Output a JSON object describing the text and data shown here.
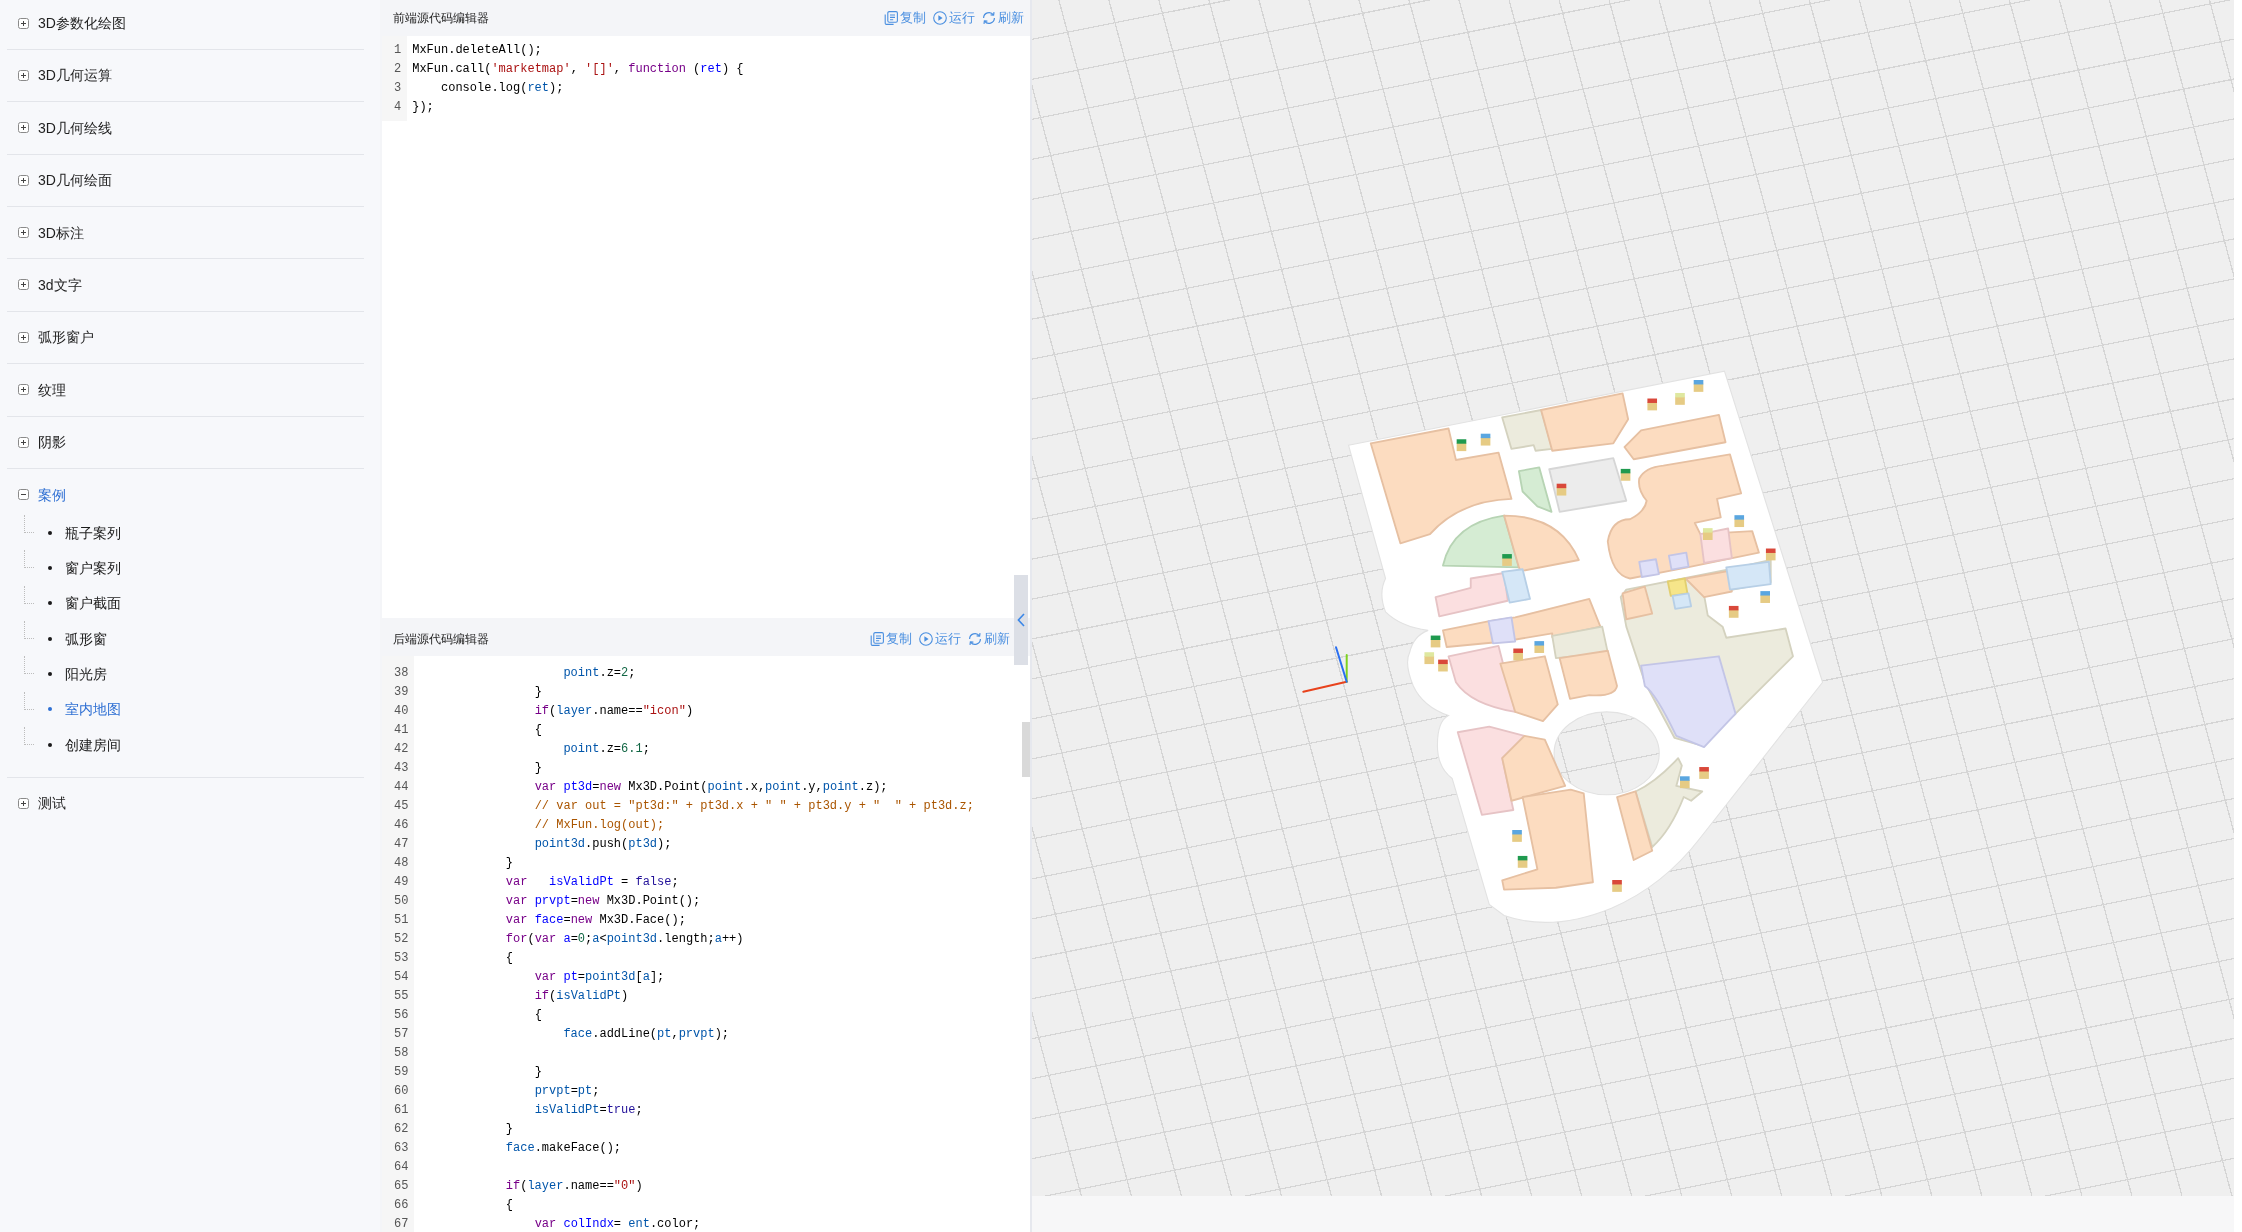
{
  "sidebar": {
    "items": [
      {
        "label": "3D参数化绘图",
        "expanded": false,
        "selected": false
      },
      {
        "label": "3D几何运算",
        "expanded": false,
        "selected": false
      },
      {
        "label": "3D几何绘线",
        "expanded": false,
        "selected": false
      },
      {
        "label": "3D几何绘面",
        "expanded": false,
        "selected": false
      },
      {
        "label": "3D标注",
        "expanded": false,
        "selected": false
      },
      {
        "label": "3d文字",
        "expanded": false,
        "selected": false
      },
      {
        "label": "弧形窗户",
        "expanded": false,
        "selected": false
      },
      {
        "label": "纹理",
        "expanded": false,
        "selected": false
      },
      {
        "label": "阴影",
        "expanded": false,
        "selected": false
      },
      {
        "label": "案例",
        "expanded": true,
        "selected": true,
        "children": [
          {
            "label": "瓶子案列",
            "selected": false
          },
          {
            "label": "窗户案列",
            "selected": false
          },
          {
            "label": "窗户截面",
            "selected": false
          },
          {
            "label": "弧形窗",
            "selected": false
          },
          {
            "label": "阳光房",
            "selected": false
          },
          {
            "label": "室内地图",
            "selected": true
          },
          {
            "label": "创建房间",
            "selected": false
          }
        ]
      },
      {
        "label": "测试",
        "expanded": false,
        "selected": false
      }
    ]
  },
  "editors": [
    {
      "title": "前端源代码编辑器",
      "actions": [
        {
          "kind": "copy",
          "label": "复制"
        },
        {
          "kind": "run",
          "label": "运行"
        },
        {
          "kind": "refresh",
          "label": "刷新"
        }
      ],
      "lines": [
        {
          "number": "1",
          "code": [
            {
              "kind": "plain",
              "text": "MxFun.deleteAll();"
            }
          ]
        },
        {
          "number": "2",
          "code": [
            {
              "kind": "plain",
              "text": "MxFun.call("
            },
            {
              "kind": "string",
              "text": "'marketmap'"
            },
            {
              "kind": "plain",
              "text": ", "
            },
            {
              "kind": "string",
              "text": "'[]'"
            },
            {
              "kind": "plain",
              "text": ", "
            },
            {
              "kind": "keyword",
              "text": "function"
            },
            {
              "kind": "plain",
              "text": " ("
            },
            {
              "kind": "def",
              "text": "ret"
            },
            {
              "kind": "plain",
              "text": ") {"
            }
          ]
        },
        {
          "number": "3",
          "code": [
            {
              "kind": "plain",
              "text": "    console.log("
            },
            {
              "kind": "variable",
              "text": "ret"
            },
            {
              "kind": "plain",
              "text": ");"
            }
          ]
        },
        {
          "number": "4",
          "code": [
            {
              "kind": "plain",
              "text": "});"
            }
          ]
        }
      ]
    },
    {
      "title": "后端源代码编辑器",
      "actions": [
        {
          "kind": "copy",
          "label": "复制"
        },
        {
          "kind": "run",
          "label": "运行"
        },
        {
          "kind": "refresh",
          "label": "刷新"
        }
      ],
      "lines": [
        {
          "number": "38",
          "code": [
            {
              "kind": "variable",
              "text": "                    point"
            },
            {
              "kind": "plain",
              "text": ".z="
            },
            {
              "kind": "number",
              "text": "2"
            },
            {
              "kind": "plain",
              "text": ";"
            }
          ]
        },
        {
          "number": "39",
          "code": [
            {
              "kind": "plain",
              "text": "                }"
            }
          ]
        },
        {
          "number": "40",
          "code": [
            {
              "kind": "keyword",
              "text": "                if"
            },
            {
              "kind": "plain",
              "text": "("
            },
            {
              "kind": "variable",
              "text": "layer"
            },
            {
              "kind": "plain",
              "text": ".name=="
            },
            {
              "kind": "string",
              "text": "\"icon\""
            },
            {
              "kind": "plain",
              "text": ")"
            }
          ]
        },
        {
          "number": "41",
          "code": [
            {
              "kind": "plain",
              "text": "                {"
            }
          ]
        },
        {
          "number": "42",
          "code": [
            {
              "kind": "variable",
              "text": "                    point"
            },
            {
              "kind": "plain",
              "text": ".z="
            },
            {
              "kind": "number",
              "text": "6.1"
            },
            {
              "kind": "plain",
              "text": ";"
            }
          ]
        },
        {
          "number": "43",
          "code": [
            {
              "kind": "plain",
              "text": "                }"
            }
          ]
        },
        {
          "number": "44",
          "code": [
            {
              "kind": "keyword",
              "text": "                var "
            },
            {
              "kind": "def",
              "text": "pt3d"
            },
            {
              "kind": "plain",
              "text": "="
            },
            {
              "kind": "keyword",
              "text": "new"
            },
            {
              "kind": "plain",
              "text": " Mx3D.Point("
            },
            {
              "kind": "variable",
              "text": "point"
            },
            {
              "kind": "plain",
              "text": ".x,"
            },
            {
              "kind": "variable",
              "text": "point"
            },
            {
              "kind": "plain",
              "text": ".y,"
            },
            {
              "kind": "variable",
              "text": "point"
            },
            {
              "kind": "plain",
              "text": ".z);"
            }
          ]
        },
        {
          "number": "45",
          "code": [
            {
              "kind": "comment",
              "text": "                // var out = \"pt3d:\" + pt3d.x + \" \" + pt3d.y + \"  \" + pt3d.z;"
            }
          ]
        },
        {
          "number": "46",
          "code": [
            {
              "kind": "comment",
              "text": "                // MxFun.log(out);"
            }
          ]
        },
        {
          "number": "47",
          "code": [
            {
              "kind": "variable",
              "text": "                point3d"
            },
            {
              "kind": "plain",
              "text": ".push("
            },
            {
              "kind": "variable",
              "text": "pt3d"
            },
            {
              "kind": "plain",
              "text": ");"
            }
          ]
        },
        {
          "number": "48",
          "code": [
            {
              "kind": "plain",
              "text": "            }"
            }
          ]
        },
        {
          "number": "49",
          "code": [
            {
              "kind": "keyword",
              "text": "            var   "
            },
            {
              "kind": "def",
              "text": "isValidPt"
            },
            {
              "kind": "plain",
              "text": " = "
            },
            {
              "kind": "atom",
              "text": "false"
            },
            {
              "kind": "plain",
              "text": ";"
            }
          ]
        },
        {
          "number": "50",
          "code": [
            {
              "kind": "keyword",
              "text": "            var "
            },
            {
              "kind": "def",
              "text": "prvpt"
            },
            {
              "kind": "plain",
              "text": "="
            },
            {
              "kind": "keyword",
              "text": "new"
            },
            {
              "kind": "plain",
              "text": " Mx3D.Point();"
            }
          ]
        },
        {
          "number": "51",
          "code": [
            {
              "kind": "keyword",
              "text": "            var "
            },
            {
              "kind": "def",
              "text": "face"
            },
            {
              "kind": "plain",
              "text": "="
            },
            {
              "kind": "keyword",
              "text": "new"
            },
            {
              "kind": "plain",
              "text": " Mx3D.Face();"
            }
          ]
        },
        {
          "number": "52",
          "code": [
            {
              "kind": "keyword",
              "text": "            for"
            },
            {
              "kind": "plain",
              "text": "("
            },
            {
              "kind": "keyword",
              "text": "var "
            },
            {
              "kind": "def",
              "text": "a"
            },
            {
              "kind": "plain",
              "text": "="
            },
            {
              "kind": "number",
              "text": "0"
            },
            {
              "kind": "plain",
              "text": ";"
            },
            {
              "kind": "variable",
              "text": "a"
            },
            {
              "kind": "plain",
              "text": "<"
            },
            {
              "kind": "variable",
              "text": "point3d"
            },
            {
              "kind": "plain",
              "text": ".length;"
            },
            {
              "kind": "variable",
              "text": "a"
            },
            {
              "kind": "plain",
              "text": "++)"
            }
          ]
        },
        {
          "number": "53",
          "code": [
            {
              "kind": "plain",
              "text": "            {"
            }
          ]
        },
        {
          "number": "54",
          "code": [
            {
              "kind": "keyword",
              "text": "                var "
            },
            {
              "kind": "def",
              "text": "pt"
            },
            {
              "kind": "plain",
              "text": "="
            },
            {
              "kind": "variable",
              "text": "point3d"
            },
            {
              "kind": "plain",
              "text": "["
            },
            {
              "kind": "variable",
              "text": "a"
            },
            {
              "kind": "plain",
              "text": "];"
            }
          ]
        },
        {
          "number": "55",
          "code": [
            {
              "kind": "keyword",
              "text": "                if"
            },
            {
              "kind": "plain",
              "text": "("
            },
            {
              "kind": "variable",
              "text": "isValidPt"
            },
            {
              "kind": "plain",
              "text": ")"
            }
          ]
        },
        {
          "number": "56",
          "code": [
            {
              "kind": "plain",
              "text": "                {"
            }
          ]
        },
        {
          "number": "57",
          "code": [
            {
              "kind": "variable",
              "text": "                    face"
            },
            {
              "kind": "plain",
              "text": ".addLine("
            },
            {
              "kind": "variable",
              "text": "pt"
            },
            {
              "kind": "plain",
              "text": ","
            },
            {
              "kind": "variable",
              "text": "prvpt"
            },
            {
              "kind": "plain",
              "text": ");"
            }
          ]
        },
        {
          "number": "58"
        },
        {
          "number": "59",
          "code": [
            {
              "kind": "plain",
              "text": "                }"
            }
          ]
        },
        {
          "number": "60",
          "code": [
            {
              "kind": "variable",
              "text": "                prvpt"
            },
            {
              "kind": "plain",
              "text": "="
            },
            {
              "kind": "variable",
              "text": "pt"
            },
            {
              "kind": "plain",
              "text": ";"
            }
          ]
        },
        {
          "number": "61",
          "code": [
            {
              "kind": "variable",
              "text": "                isValidPt"
            },
            {
              "kind": "plain",
              "text": "="
            },
            {
              "kind": "atom",
              "text": "true"
            },
            {
              "kind": "plain",
              "text": ";"
            }
          ]
        },
        {
          "number": "62",
          "code": [
            {
              "kind": "plain",
              "text": "            }"
            }
          ]
        },
        {
          "number": "63",
          "code": [
            {
              "kind": "variable",
              "text": "            face"
            },
            {
              "kind": "plain",
              "text": ".makeFace();"
            }
          ]
        },
        {
          "number": "64"
        },
        {
          "number": "65",
          "code": [
            {
              "kind": "keyword",
              "text": "            if"
            },
            {
              "kind": "plain",
              "text": "("
            },
            {
              "kind": "variable",
              "text": "layer"
            },
            {
              "kind": "plain",
              "text": ".name=="
            },
            {
              "kind": "string",
              "text": "\"0\""
            },
            {
              "kind": "plain",
              "text": ")"
            }
          ]
        },
        {
          "number": "66",
          "code": [
            {
              "kind": "plain",
              "text": "            {"
            }
          ]
        },
        {
          "number": "67",
          "code": [
            {
              "kind": "keyword",
              "text": "                var "
            },
            {
              "kind": "def",
              "text": "colIndx"
            },
            {
              "kind": "plain",
              "text": "= "
            },
            {
              "kind": "variable",
              "text": "ent"
            },
            {
              "kind": "plain",
              "text": ".color;"
            }
          ]
        }
      ]
    }
  ]
}
